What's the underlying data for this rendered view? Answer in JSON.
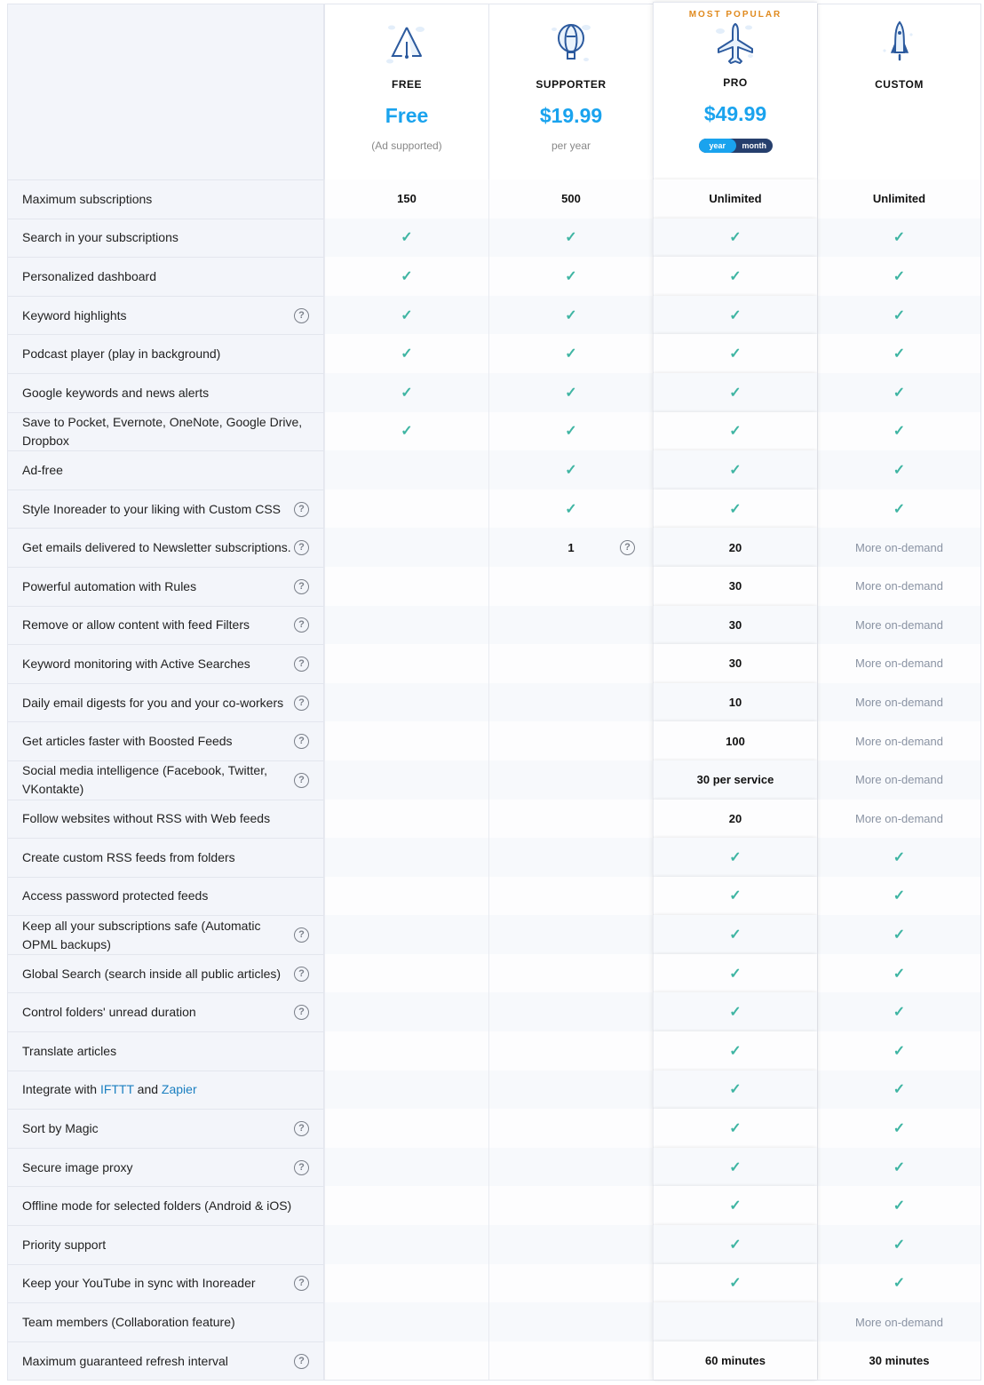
{
  "plans": [
    {
      "name": "FREE",
      "price": "Free",
      "sub": "(Ad supported)",
      "icon": "paper-plane-icon"
    },
    {
      "name": "SUPPORTER",
      "price": "$19.99",
      "sub": "per year",
      "icon": "hot-air-balloon-icon"
    },
    {
      "name": "PRO",
      "price": "$49.99",
      "badge": "MOST POPULAR",
      "toggle": {
        "year": "year",
        "month": "month",
        "selected": "year"
      },
      "icon": "airplane-icon"
    },
    {
      "name": "CUSTOM",
      "icon": "rocket-icon"
    }
  ],
  "colors": {
    "accent": "#1aa3ee",
    "check": "#3fb5a3",
    "popular": "#e08a1e",
    "toggle_bg": "#263f6d"
  },
  "features": [
    {
      "label": "Maximum subscriptions",
      "help": false,
      "values": [
        "150",
        "500",
        "Unlimited",
        "Unlimited"
      ]
    },
    {
      "label": "Search in your subscriptions",
      "help": false,
      "values": [
        "✓",
        "✓",
        "✓",
        "✓"
      ]
    },
    {
      "label": "Personalized dashboard",
      "help": false,
      "values": [
        "✓",
        "✓",
        "✓",
        "✓"
      ]
    },
    {
      "label": "Keyword highlights",
      "help": true,
      "values": [
        "✓",
        "✓",
        "✓",
        "✓"
      ]
    },
    {
      "label": "Podcast player (play in background)",
      "help": false,
      "values": [
        "✓",
        "✓",
        "✓",
        "✓"
      ]
    },
    {
      "label": "Google keywords and news alerts",
      "help": false,
      "values": [
        "✓",
        "✓",
        "✓",
        "✓"
      ]
    },
    {
      "label": "Save to Pocket, Evernote, OneNote, Google Drive, Dropbox",
      "help": false,
      "values": [
        "✓",
        "✓",
        "✓",
        "✓"
      ]
    },
    {
      "label": "Ad-free",
      "help": false,
      "values": [
        "",
        "✓",
        "✓",
        "✓"
      ]
    },
    {
      "label": "Style Inoreader to your liking with Custom CSS",
      "help": true,
      "values": [
        "",
        "✓",
        "✓",
        "✓"
      ]
    },
    {
      "label": "Get emails delivered to Newsletter subscriptions.",
      "help": true,
      "values": [
        "",
        "1",
        "20",
        "More on-demand"
      ],
      "cell_help": 1
    },
    {
      "label": "Powerful automation with Rules",
      "help": true,
      "values": [
        "",
        "",
        "30",
        "More on-demand"
      ]
    },
    {
      "label": "Remove or allow content with feed Filters",
      "help": true,
      "values": [
        "",
        "",
        "30",
        "More on-demand"
      ]
    },
    {
      "label": "Keyword monitoring with Active Searches",
      "help": true,
      "values": [
        "",
        "",
        "30",
        "More on-demand"
      ]
    },
    {
      "label": "Daily email digests for you and your co-workers",
      "help": true,
      "values": [
        "",
        "",
        "10",
        "More on-demand"
      ]
    },
    {
      "label": "Get articles faster with Boosted Feeds",
      "help": true,
      "values": [
        "",
        "",
        "100",
        "More on-demand"
      ]
    },
    {
      "label": "Social media intelligence (Facebook, Twitter, VKontakte)",
      "help": true,
      "values": [
        "",
        "",
        "30 per service",
        "More on-demand"
      ]
    },
    {
      "label": "Follow websites without RSS with Web feeds",
      "help": false,
      "values": [
        "",
        "",
        "20",
        "More on-demand"
      ]
    },
    {
      "label": "Create custom RSS feeds from folders",
      "help": false,
      "values": [
        "",
        "",
        "✓",
        "✓"
      ]
    },
    {
      "label": "Access password protected feeds",
      "help": false,
      "values": [
        "",
        "",
        "✓",
        "✓"
      ]
    },
    {
      "label": "Keep all your subscriptions safe (Automatic OPML backups)",
      "help": true,
      "values": [
        "",
        "",
        "✓",
        "✓"
      ]
    },
    {
      "label": "Global Search (search inside all public articles)",
      "help": true,
      "values": [
        "",
        "",
        "✓",
        "✓"
      ]
    },
    {
      "label": "Control folders' unread duration",
      "help": true,
      "values": [
        "",
        "",
        "✓",
        "✓"
      ]
    },
    {
      "label": "Translate articles",
      "help": false,
      "values": [
        "",
        "",
        "✓",
        "✓"
      ]
    },
    {
      "label": "Integrate with IFTTT and Zapier",
      "help": false,
      "links": {
        "prefix": "Integrate with ",
        "link1": "IFTTT",
        "mid": " and ",
        "link2": "Zapier"
      },
      "values": [
        "",
        "",
        "✓",
        "✓"
      ]
    },
    {
      "label": "Sort by Magic",
      "help": true,
      "values": [
        "",
        "",
        "✓",
        "✓"
      ]
    },
    {
      "label": "Secure image proxy",
      "help": true,
      "values": [
        "",
        "",
        "✓",
        "✓"
      ]
    },
    {
      "label": "Offline mode for selected folders (Android & iOS)",
      "help": false,
      "values": [
        "",
        "",
        "✓",
        "✓"
      ]
    },
    {
      "label": "Priority support",
      "help": false,
      "values": [
        "",
        "",
        "✓",
        "✓"
      ]
    },
    {
      "label": "Keep your YouTube in sync with Inoreader",
      "help": true,
      "values": [
        "",
        "",
        "✓",
        "✓"
      ]
    },
    {
      "label": "Team members (Collaboration feature)",
      "help": false,
      "values": [
        "",
        "",
        "",
        "More on-demand"
      ]
    },
    {
      "label": "Maximum guaranteed refresh interval",
      "help": true,
      "values": [
        "",
        "",
        "60 minutes",
        "30 minutes"
      ]
    }
  ]
}
